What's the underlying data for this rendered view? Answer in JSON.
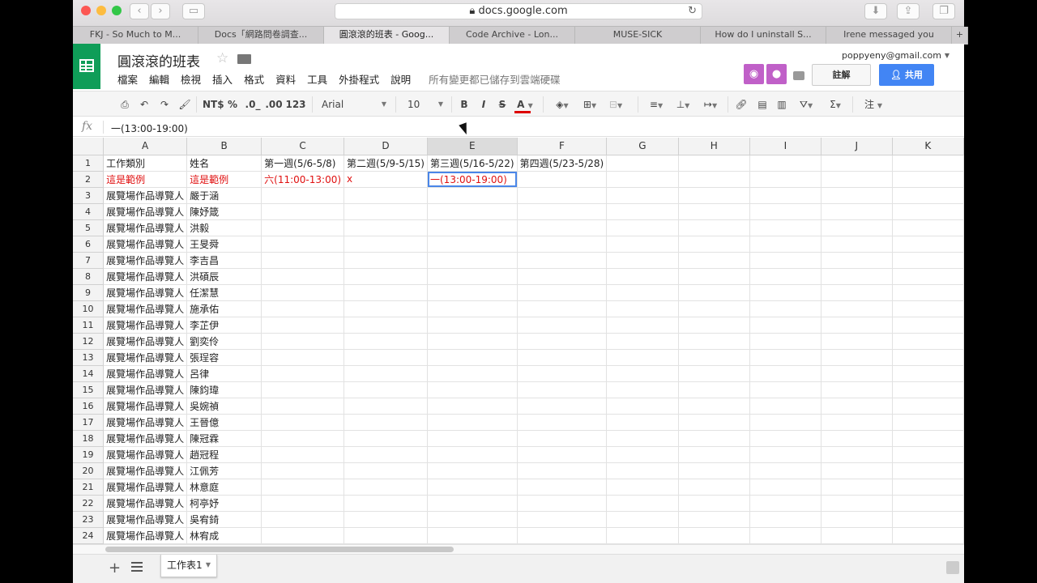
{
  "browser": {
    "url": "docs.google.com",
    "tabs": [
      {
        "label": "FKJ - So Much to M..."
      },
      {
        "label": "Docs「網路問卷調查..."
      },
      {
        "label": "圓滾滾的班表 - Goog...",
        "active": true
      },
      {
        "label": "Code Archive - Lon..."
      },
      {
        "label": "MUSE-SICK"
      },
      {
        "label": "How do I uninstall S..."
      },
      {
        "label": "Irene messaged you"
      }
    ]
  },
  "header": {
    "title": "圓滾滾的班表",
    "menus": [
      "檔案",
      "編輯",
      "檢視",
      "插入",
      "格式",
      "資料",
      "工具",
      "外掛程式",
      "說明"
    ],
    "save_status": "所有變更都已儲存到雲端硬碟",
    "email": "poppyeny@gmail.com",
    "comment_label": "註解",
    "share_label": "共用"
  },
  "toolbar": {
    "currency": "NT$",
    "percent": "%",
    "dec_less": ".0_",
    "dec_more": ".00",
    "more_formats": "123",
    "font": "Arial",
    "size": "10",
    "bold": "B",
    "italic": "I",
    "strike": "S",
    "text_color": "A",
    "sum": "Σ",
    "input_tools": "注"
  },
  "formula_bar": {
    "fx": "fx",
    "value": "一(13:00-19:00)"
  },
  "sheet": {
    "columns": [
      "A",
      "B",
      "C",
      "D",
      "E",
      "F",
      "G",
      "H",
      "I",
      "J",
      "K"
    ],
    "selected_column": "E",
    "rows": [
      [
        "工作類別",
        "姓名",
        "第一週(5/6-5/8)",
        "第二週(5/9-5/15)",
        "第三週(5/16-5/22)",
        "第四週(5/23-5/28)",
        "",
        "",
        "",
        "",
        ""
      ],
      [
        "這是範例",
        "這是範例",
        "六(11:00-13:00)",
        "x",
        "一(13:00-19:00)",
        "",
        "",
        "",
        "",
        "",
        ""
      ],
      [
        "展覽場作品導覽人",
        "嚴于涵"
      ],
      [
        "展覽場作品導覽人",
        "陳妤箴"
      ],
      [
        "展覽場作品導覽人",
        "洪毅"
      ],
      [
        "展覽場作品導覽人",
        "王旻舜"
      ],
      [
        "展覽場作品導覽人",
        "李吉昌"
      ],
      [
        "展覽場作品導覽人",
        "洪碩辰"
      ],
      [
        "展覽場作品導覽人",
        "任潔慧"
      ],
      [
        "展覽場作品導覽人",
        "施承佑"
      ],
      [
        "展覽場作品導覽人",
        "李芷伊"
      ],
      [
        "展覽場作品導覽人",
        "劉奕伶"
      ],
      [
        "展覽場作品導覽人",
        "張珵容"
      ],
      [
        "展覽場作品導覽人",
        "呂律"
      ],
      [
        "展覽場作品導覽人",
        "陳鈞瑋"
      ],
      [
        "展覽場作品導覽人",
        "吳婉禎"
      ],
      [
        "展覽場作品導覽人",
        "王晉億"
      ],
      [
        "展覽場作品導覽人",
        "陳冠霖"
      ],
      [
        "展覽場作品導覽人",
        "趙冠程"
      ],
      [
        "展覽場作品導覽人",
        "江佩芳"
      ],
      [
        "展覽場作品導覽人",
        "林意庭"
      ],
      [
        "展覽場作品導覽人",
        "柯亭妤"
      ],
      [
        "展覽場作品導覽人",
        "吳宥錡"
      ],
      [
        "展覽場作品導覽人",
        "林宥成"
      ]
    ],
    "tab_name": "工作表1"
  },
  "colors": {
    "sheets_green": "#0f9d58",
    "share_blue": "#4285f4",
    "example_red": "#e01010",
    "selection_blue": "#4a86e8"
  },
  "icons": [
    "print-icon",
    "undo-icon",
    "redo-icon",
    "paint-format-icon",
    "fill-color-icon",
    "borders-icon",
    "merge-icon",
    "align-icon",
    "valign-icon",
    "wrap-icon",
    "link-icon",
    "comment-icon",
    "chart-icon",
    "filter-icon"
  ]
}
